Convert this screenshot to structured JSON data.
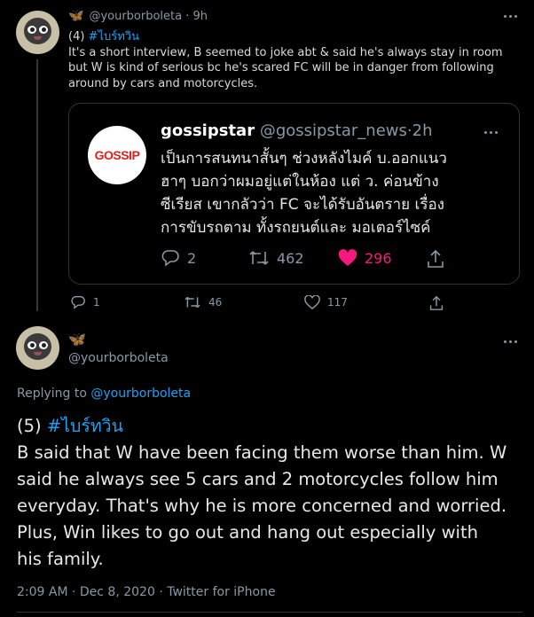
{
  "tweet1": {
    "handle": "@yourborboleta",
    "separator": "·",
    "time": "9h",
    "text": {
      "prefix": "(4) ",
      "hashtag": "#ไบร์ทวิน",
      "lines": [
        "It's a short interview, B seemed to joke abt & said he's always stay in room",
        "but W is kind of serious bc he's scared FC will be in danger from following",
        "around by cars and motorcycles."
      ]
    },
    "quoted": {
      "logo_text": "GOSSIP",
      "name": "gossipstar",
      "handle": "@gossipstar_news",
      "separator": "·",
      "time": "2h",
      "lines": [
        "เป็นการสนทนาสั้นๆ ช่วงหลังไมค์ บ.ออกแนว",
        "ฮาๆ บอกว่าผมอยู่แต่ในห้อง แต่ ว. ค่อนข้าง",
        "ซีเรียส เขากลัวว่า FC จะได้รับอันตราย เรื่อง",
        "การขับรถตาม ทั้งรถยนต์และ มอเตอร์ไซค์"
      ],
      "actions": {
        "replies": "2",
        "retweets": "462",
        "likes": "296"
      }
    },
    "actions": {
      "replies": "1",
      "retweets": "46",
      "likes": "117"
    }
  },
  "tweet2": {
    "handle": "@yourborboleta",
    "replying_label": "Replying to",
    "replying_handle": "@yourborboleta",
    "text": {
      "prefix": "(5) ",
      "hashtag": "#ไบร์ทวิน",
      "lines": [
        "B said that W have been facing them worse than him. W",
        "said he always see 5 cars and 2 motorcycles follow him",
        "everyday. That's why he is more concerned and worried.",
        "Plus, Win likes to go out and hang out especially with",
        "his family."
      ]
    },
    "meta": "2:09 AM · Dec 8, 2020 · Twitter for iPhone"
  },
  "colors": {
    "background": "#000000",
    "link": "#1da1f2",
    "secondary": "#8899a6",
    "like": "#f91880",
    "gossip_red": "#e0201c"
  }
}
